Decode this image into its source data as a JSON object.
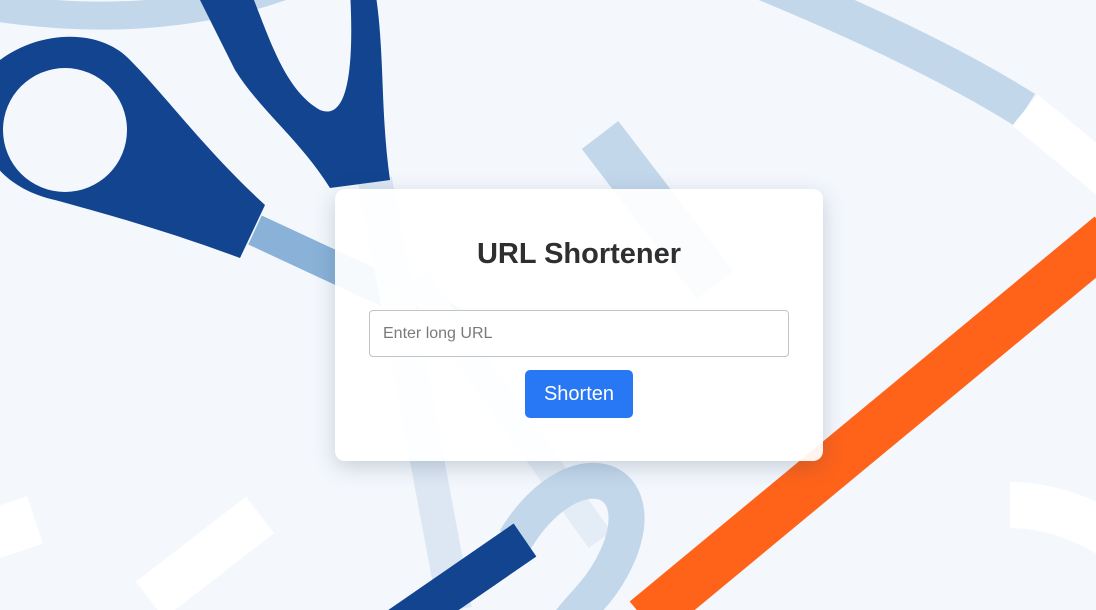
{
  "app": {
    "title": "URL Shortener"
  },
  "form": {
    "url_placeholder": "Enter long URL",
    "url_value": "",
    "submit_label": "Shorten"
  },
  "colors": {
    "background": "#f4f8fd",
    "accent_button": "#2878f5",
    "scissors_dark_blue": "#12448f",
    "light_blue_strips": "#bfd5ea",
    "orange_strip": "#ff631a"
  },
  "background_art": {
    "icon": "scissors-icon"
  }
}
